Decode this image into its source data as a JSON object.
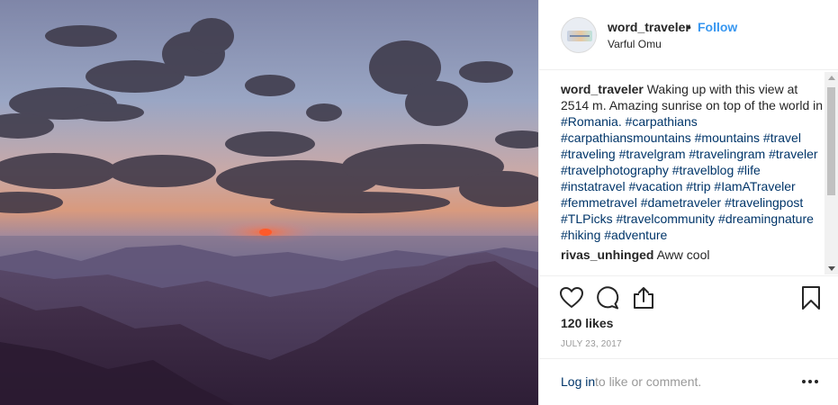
{
  "post": {
    "username": "word_traveler",
    "separator": "•",
    "follow_label": "Follow",
    "location": "Varful Omu"
  },
  "caption": {
    "username": "word_traveler",
    "text": "Waking up with this view at 2514 m. Amazing sunrise on top of the world in ",
    "tag_romania": "#Romania.",
    "tags": "#carpathians #carpathiansmountains #mountains #travel #traveling #travelgram #travelingram #traveler #travelphotography #travelblog #life #instatravel #vacation #trip #IamATraveler #femmetravel #dametraveler #travelingpost #TLPicks #travelcommunity #dreamingnature #hiking #adventure"
  },
  "comment": {
    "username": "rivas_unhinged",
    "text": "Aww cool"
  },
  "likes": "120 likes",
  "date": "JULY 23, 2017",
  "footer": {
    "login_label": "Log in",
    "login_rest": "to like or comment."
  },
  "icons": {
    "like": "heart-icon",
    "comment": "comment-icon",
    "share": "share-icon",
    "save": "bookmark-icon",
    "more": "more-options-icon"
  }
}
